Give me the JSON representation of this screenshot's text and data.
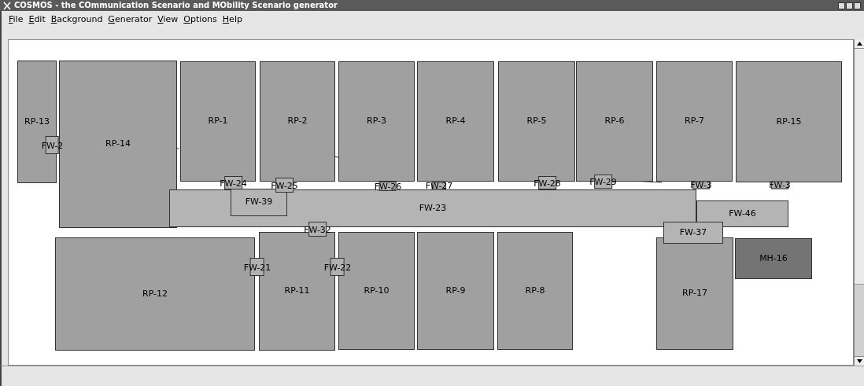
{
  "window": {
    "title": "COSMOS - the COmmunication Scenario and MObility Scenario generator"
  },
  "menu": [
    {
      "label": "File"
    },
    {
      "label": "Edit"
    },
    {
      "label": "Background"
    },
    {
      "label": "Generator"
    },
    {
      "label": "View"
    },
    {
      "label": "Options"
    },
    {
      "label": "Help"
    }
  ],
  "nodes": [
    {
      "label": "RP-13",
      "kind": "room"
    },
    {
      "label": "RP-14",
      "kind": "room"
    },
    {
      "label": "RP-1",
      "kind": "room"
    },
    {
      "label": "RP-2",
      "kind": "room"
    },
    {
      "label": "RP-3",
      "kind": "room"
    },
    {
      "label": "RP-4",
      "kind": "room"
    },
    {
      "label": "RP-5",
      "kind": "room"
    },
    {
      "label": "RP-6",
      "kind": "room"
    },
    {
      "label": "RP-7",
      "kind": "room"
    },
    {
      "label": "RP-15",
      "kind": "room"
    },
    {
      "label": "RP-12",
      "kind": "room"
    },
    {
      "label": "RP-11",
      "kind": "room"
    },
    {
      "label": "RP-10",
      "kind": "room"
    },
    {
      "label": "RP-9",
      "kind": "room"
    },
    {
      "label": "RP-8",
      "kind": "room"
    },
    {
      "label": "RP-17",
      "kind": "room"
    },
    {
      "label": "FW-23",
      "kind": "corridor"
    },
    {
      "label": "FW-39",
      "kind": "corridor"
    },
    {
      "label": "FW-46",
      "kind": "corridor"
    },
    {
      "label": "FW-37",
      "kind": "corridor"
    },
    {
      "label": "MH-16",
      "kind": "host"
    },
    {
      "label": "FW-2",
      "kind": "door"
    },
    {
      "label": "FW-24",
      "kind": "door"
    },
    {
      "label": "FW-25",
      "kind": "door"
    },
    {
      "label": "FW-26",
      "kind": "door"
    },
    {
      "label": "FW-27",
      "kind": "door"
    },
    {
      "label": "FW-28",
      "kind": "door"
    },
    {
      "label": "FW-29",
      "kind": "door"
    },
    {
      "label": "FW-3",
      "kind": "door"
    },
    {
      "label": "FW-3",
      "kind": "door"
    },
    {
      "label": "FW-32",
      "kind": "door"
    },
    {
      "label": "FW-21",
      "kind": "door"
    },
    {
      "label": "FW-22",
      "kind": "door"
    }
  ]
}
